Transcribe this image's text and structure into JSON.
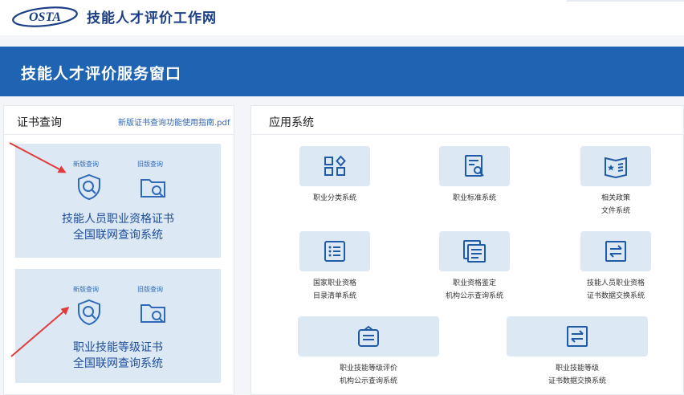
{
  "header": {
    "logo_text": "OSTA",
    "site_title": "技能人才评价工作网"
  },
  "banner": {
    "title": "技能人才评价服务窗口"
  },
  "cert_query": {
    "title": "证书查询",
    "guide_link": "新版证书查询功能使用指南.pdf",
    "cards": [
      {
        "new_label": "新版查询",
        "old_label": "旧版查询",
        "name_line1": "技能人员职业资格证书",
        "name_line2": "全国联网查询系统"
      },
      {
        "new_label": "新版查询",
        "old_label": "旧版查询",
        "name_line1": "职业技能等级证书",
        "name_line2": "全国联网查询系统"
      }
    ]
  },
  "apps": {
    "title": "应用系统",
    "items": [
      {
        "line1": "职业分类系统",
        "line2": "",
        "icon": "grid-icon"
      },
      {
        "line1": "职业标准系统",
        "line2": "",
        "icon": "document-search-icon"
      },
      {
        "line1": "相关政策",
        "line2": "文件系统",
        "icon": "policy-book-icon"
      },
      {
        "line1": "国家职业资格",
        "line2": "目录清单系统",
        "icon": "list-icon"
      },
      {
        "line1": "职业资格鉴定",
        "line2": "机构公示查询系统",
        "icon": "document-stack-icon"
      },
      {
        "line1": "技能人员职业资格",
        "line2": "证书数据交换系统",
        "icon": "exchange-icon"
      },
      {
        "line1": "职业技能等级评价",
        "line2": "机构公示查询系统",
        "icon": "institution-icon"
      },
      {
        "line1": "职业技能等级",
        "line2": "证书数据交换系统",
        "icon": "exchange-icon"
      }
    ]
  },
  "colors": {
    "brand_blue": "#1f63b3",
    "tile_bg": "#dce8f4",
    "arrow_red": "#e23b3b"
  }
}
